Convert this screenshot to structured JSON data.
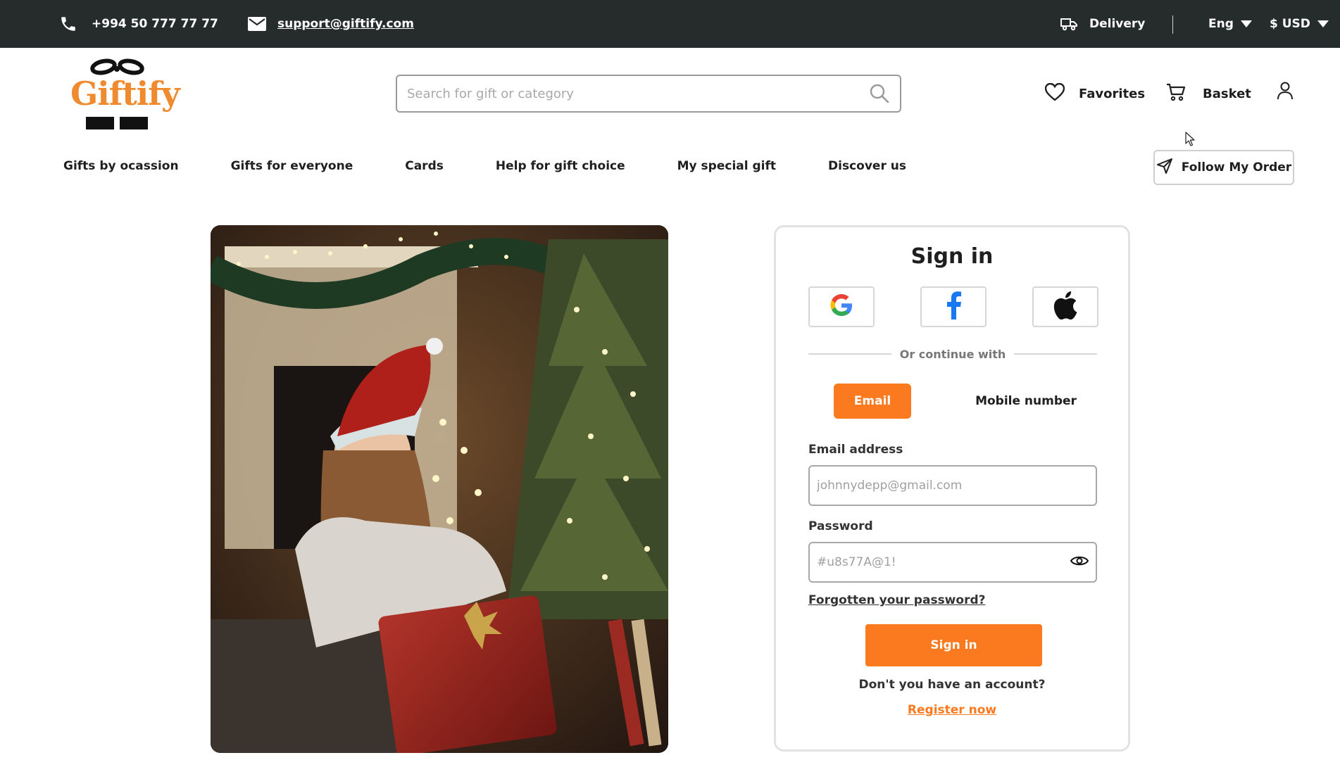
{
  "topbar": {
    "phone": "+994 50 777 77 77",
    "email": "support@giftify.com",
    "delivery": "Delivery",
    "language": "Eng",
    "currency": "$ USD"
  },
  "header": {
    "logo_text": "Giftify",
    "search_placeholder": "Search for gift or category",
    "favorites": "Favorites",
    "basket": "Basket"
  },
  "nav": {
    "items": [
      "Gifts by ocassion",
      "Gifts for everyone",
      "Cards",
      "Help for gift choice",
      "My special gift",
      "Discover us"
    ],
    "follow_order": "Follow My Order"
  },
  "signin": {
    "title": "Sign in",
    "divider": "Or continue with",
    "tab_email": "Email",
    "tab_mobile": "Mobile number",
    "email_label": "Email address",
    "email_placeholder": "johnnydepp@gmail.com",
    "password_label": "Password",
    "password_placeholder": "#u8s77A@1!",
    "forgot": "Forgotten your password?",
    "submit": "Sign in",
    "no_account": "Don't you have an account?",
    "register": "Register now"
  },
  "colors": {
    "accent": "#fb7a20",
    "topbar_bg": "#262c2c",
    "logo": "#f08a2e"
  }
}
